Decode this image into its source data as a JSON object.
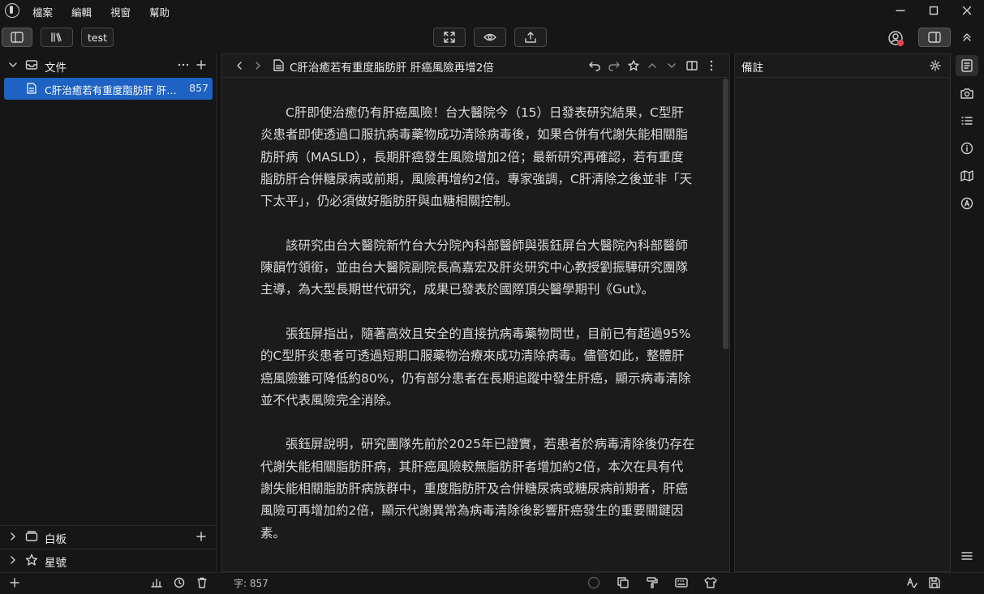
{
  "menu": [
    "檔案",
    "編輯",
    "視窗",
    "幫助"
  ],
  "toolbar": {
    "tab_label": "test"
  },
  "sidebar": {
    "files_label": "文件",
    "active_file": {
      "title": "C肝治癒若有重度脂肪肝 肝癌風險再增2倍",
      "count": "857"
    },
    "whiteboard_label": "白板",
    "starred_label": "星號"
  },
  "editor": {
    "title": "C肝治癒若有重度脂肪肝 肝癌風險再增2倍",
    "paragraphs": [
      "C肝即使治癒仍有肝癌風險！台大醫院今（15）日發表研究結果，C型肝炎患者即使透過口服抗病毒藥物成功清除病毒後，如果合併有代謝失能相關脂肪肝病（MASLD），長期肝癌發生風險增加2倍；最新研究再確認，若有重度脂肪肝合併糖尿病或前期，風險再增約2倍。專家強調，C肝清除之後並非「天下太平」，仍必須做好脂肪肝與血糖相關控制。",
      "該研究由台大醫院新竹台大分院內科部醫師與張鈺屏台大醫院內科部醫師陳韻竹領銜，並由台大醫院副院長高嘉宏及肝炎研究中心教授劉振驊研究團隊主導，為大型長期世代研究，成果已發表於國際頂尖醫學期刊《Gut》。",
      "張鈺屏指出，隨著高效且安全的直接抗病毒藥物問世，目前已有超過95%的C型肝炎患者可透過短期口服藥物治療來成功清除病毒。儘管如此，整體肝癌風險雖可降低約80%，仍有部分患者在長期追蹤中發生肝癌，顯示病毒清除並不代表風險完全消除。",
      "張鈺屏說明，研究團隊先前於2025年已證實，若患者於病毒清除後仍存在代謝失能相關脂肪肝病，其肝癌風險較無脂肪肝者增加約2倍，本次在具有代謝失能相關脂肪肝病族群中，重度脂肪肝及合併糖尿病或糖尿病前期者，肝癌風險可再增加約2倍，顯示代謝異常為病毒清除後影響肝癌發生的重要關鍵因素。"
    ]
  },
  "notes": {
    "title": "備註"
  },
  "status": {
    "word_count": "字: 857"
  },
  "colors": {
    "accent": "#1e62c4",
    "background": "#111111",
    "panel": "#1b1b1b",
    "badge": "#e04a4a"
  }
}
